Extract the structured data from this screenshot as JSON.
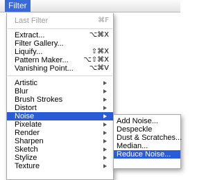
{
  "menubar": {
    "title": "Filter"
  },
  "menu": {
    "items": [
      {
        "label": "Last Filter",
        "shortcut": "⌘F",
        "disabled": true
      },
      {
        "label": "Extract...",
        "shortcut": "⌥⌘X"
      },
      {
        "label": "Filter Gallery..."
      },
      {
        "label": "Liquify...",
        "shortcut": "⇧⌘X"
      },
      {
        "label": "Pattern Maker...",
        "shortcut": "⌥⇧⌘X"
      },
      {
        "label": "Vanishing Point...",
        "shortcut": "⌥⌘V"
      },
      {
        "label": "Artistic",
        "submenu": true
      },
      {
        "label": "Blur",
        "submenu": true
      },
      {
        "label": "Brush Strokes",
        "submenu": true
      },
      {
        "label": "Distort",
        "submenu": true
      },
      {
        "label": "Noise",
        "submenu": true,
        "highlighted": true
      },
      {
        "label": "Pixelate",
        "submenu": true
      },
      {
        "label": "Render",
        "submenu": true
      },
      {
        "label": "Sharpen",
        "submenu": true
      },
      {
        "label": "Sketch",
        "submenu": true
      },
      {
        "label": "Stylize",
        "submenu": true
      },
      {
        "label": "Texture",
        "submenu": true
      }
    ]
  },
  "submenu": {
    "items": [
      {
        "label": "Add Noise..."
      },
      {
        "label": "Despeckle"
      },
      {
        "label": "Dust & Scratches..."
      },
      {
        "label": "Median..."
      },
      {
        "label": "Reduce Noise...",
        "highlighted": true
      }
    ]
  },
  "colors": {
    "highlight": "#2b5bd6",
    "menubar_title_bg": "#3a69d8",
    "disabled_text": "#9b9b9b"
  }
}
